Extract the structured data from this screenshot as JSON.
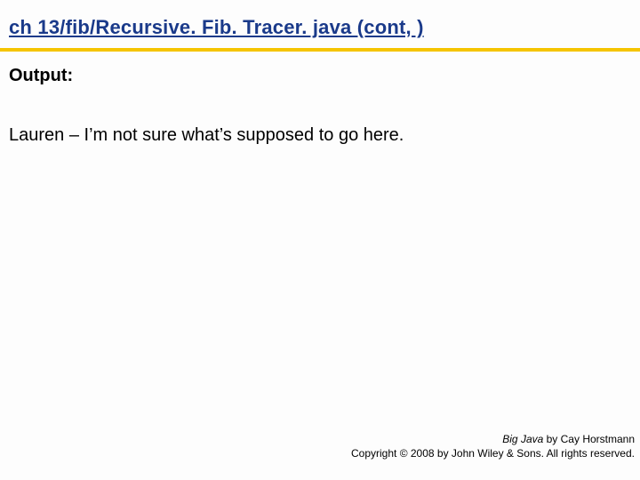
{
  "slide": {
    "title": "ch 13/fib/Recursive. Fib. Tracer. java  (cont, )",
    "output_label": "Output:",
    "body_text": "Lauren – I’m not sure what’s supposed to go here."
  },
  "footer": {
    "book_title": "Big Java",
    "byline": " by Cay Horstmann",
    "copyright": "Copyright © 2008 by John Wiley & Sons. All rights reserved."
  }
}
